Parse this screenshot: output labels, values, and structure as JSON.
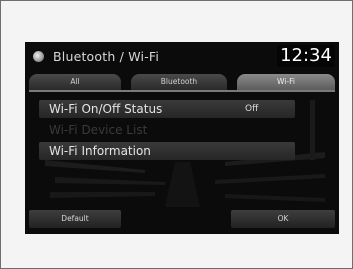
{
  "header": {
    "title": "Bluetooth / Wi-Fi",
    "icon": "settings-icon",
    "clock": "12:34"
  },
  "tabs": [
    {
      "label": "All",
      "active": false
    },
    {
      "label": "Bluetooth",
      "active": false
    },
    {
      "label": "Wi-Fi",
      "active": true
    }
  ],
  "menu": {
    "items": [
      {
        "label": "Wi-Fi On/Off Status",
        "value": "Off",
        "enabled": true
      },
      {
        "label": "Wi-Fi Device List",
        "enabled": false
      },
      {
        "label": "Wi-Fi Information",
        "enabled": true
      }
    ]
  },
  "footer": {
    "default_label": "Default",
    "ok_label": "OK"
  },
  "colors": {
    "screen_bg": "#0b0b0b",
    "active_tab": "#8a8a8a",
    "text": "#e4e4e4",
    "disabled_text": "#3a3a3a"
  }
}
